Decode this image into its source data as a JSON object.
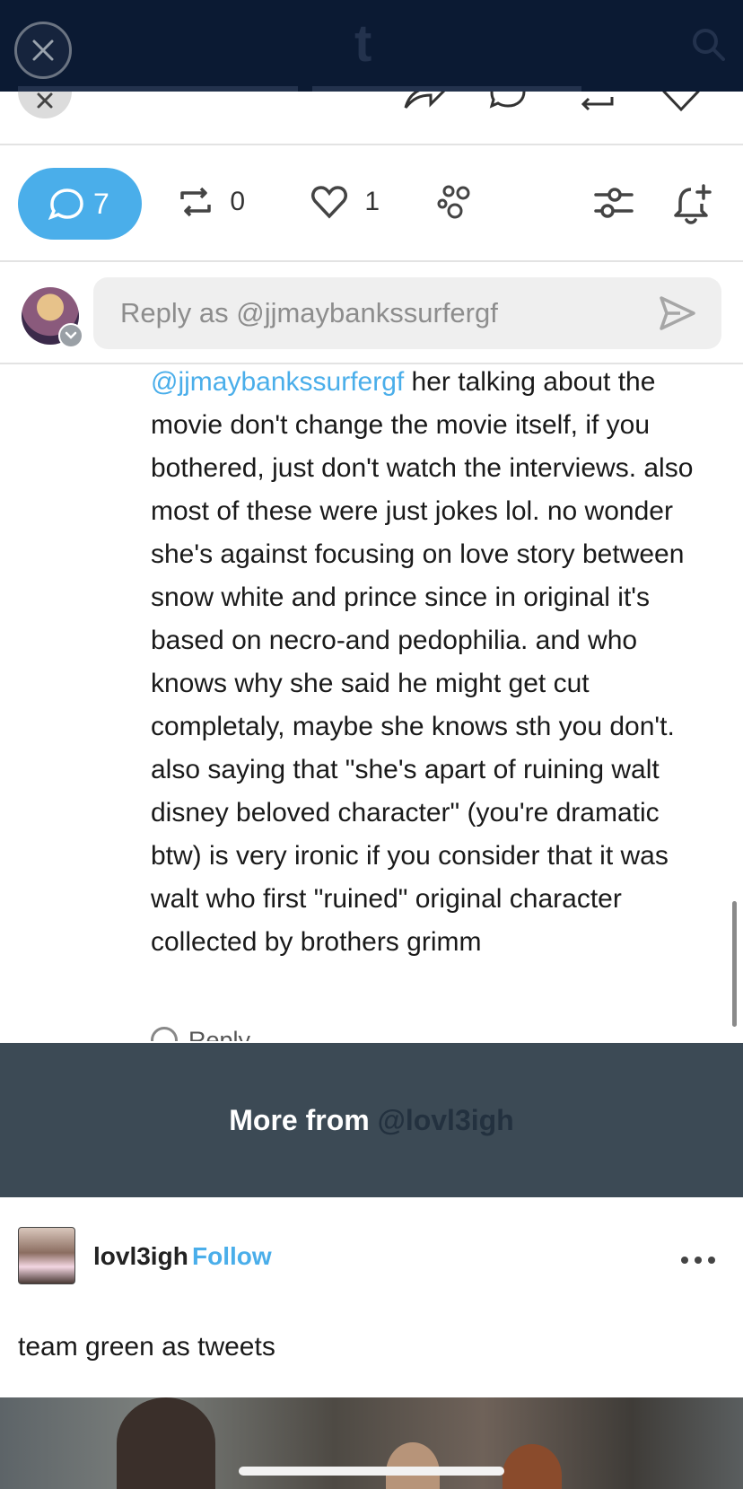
{
  "header": {
    "logo_letter": "t"
  },
  "actions": {
    "comments_count": "7",
    "reblogs_count": "0",
    "likes_count": "1"
  },
  "reply": {
    "placeholder": "Reply as @jjmaybankssurfergf"
  },
  "comment": {
    "mention": "@jjmaybankssurfergf",
    "body": " her talking about the movie don't change the movie itself, if you bothered, just don't watch the interviews. also most of these were just jokes lol. no wonder she's against focusing on love story between snow white and prince since in original it's based on necro-and pedophilia. and who knows why she said he might get cut completaly, maybe she knows sth you don't. also saying that \"she's apart of ruining walt disney beloved character\" (you're dramatic btw) is very ironic if you consider that it was walt who first \"ruined\" original character collected by brothers grimm",
    "reply_label": "Reply"
  },
  "banner": {
    "prefix": "More from ",
    "handle": "@lovl3igh"
  },
  "post": {
    "username": "lovl3igh",
    "follow_label": "Follow",
    "caption": "team green as tweets"
  },
  "colors": {
    "accent": "#4aaeea",
    "topbar": "#0b1a33",
    "banner": "#3c4a55"
  }
}
